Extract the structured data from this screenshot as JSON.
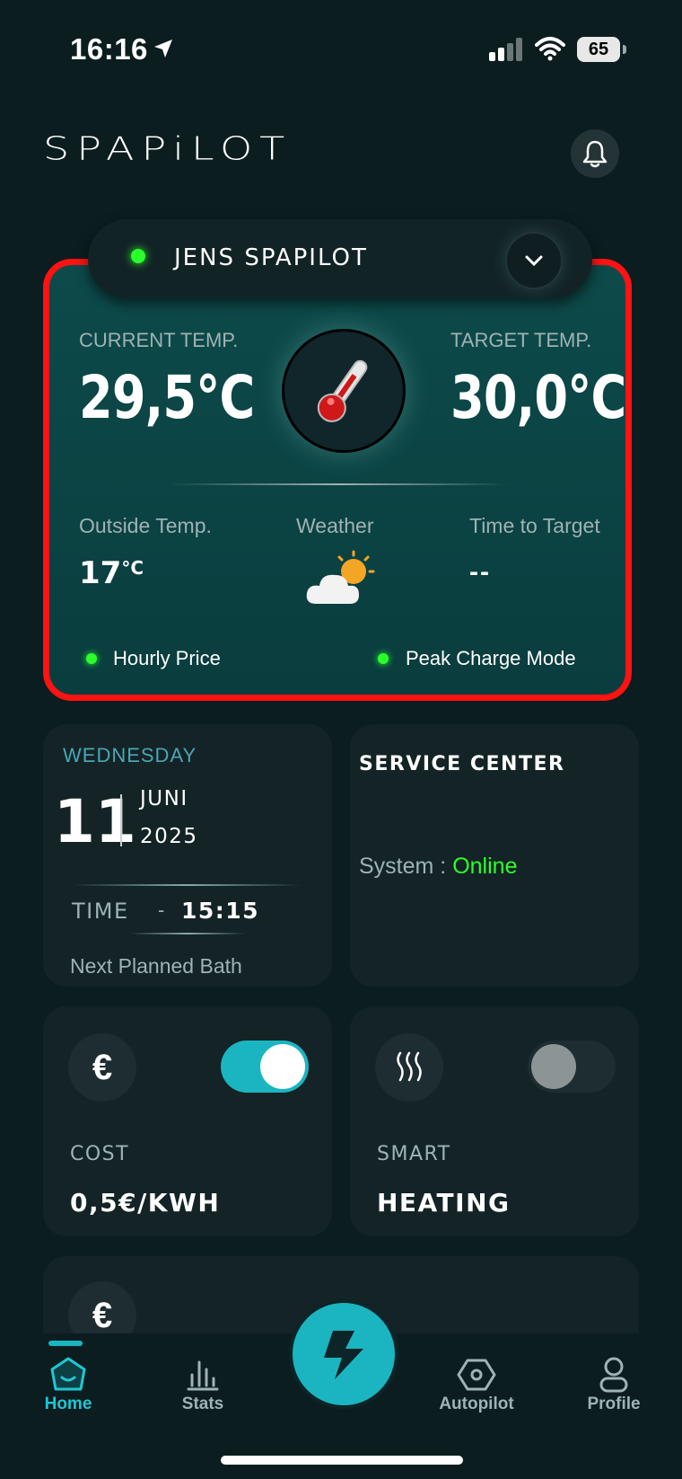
{
  "status_bar": {
    "time": "16:16",
    "battery": "65"
  },
  "header": {
    "app_title": "SPAPiLOT",
    "bell_icon": "bell-icon"
  },
  "device": {
    "name": "JENS SPAPILOT",
    "status_color": "#2bff2b"
  },
  "hero": {
    "current_label": "CURRENT TEMP.",
    "current_value": "29,5°C",
    "target_label": "TARGET TEMP.",
    "target_value": "30,0°C",
    "outside_label": "Outside Temp.",
    "outside_value": "17",
    "outside_unit": "°C",
    "weather_label": "Weather",
    "weather_icon": "partly-cloudy-icon",
    "ttt_label": "Time to Target",
    "ttt_value": "--",
    "hourly_price": "Hourly Price",
    "peak_charge": "Peak Charge Mode",
    "border_color": "#ff1212"
  },
  "date_card": {
    "weekday": "WEDNESDAY",
    "day": "11",
    "month": "JUNI",
    "year": "2025",
    "time_label": "TIME",
    "time_sep": "-",
    "time_value": "15:15",
    "next_bath": "Next Planned Bath"
  },
  "service": {
    "title": "SERVICE CENTER",
    "system_label": "System :",
    "system_status": "Online",
    "status_color": "#2bff2b"
  },
  "cost": {
    "icon": "euro-icon",
    "enabled": true,
    "label": "COST",
    "value": "0,5€/KWH"
  },
  "smart": {
    "icon": "heat-waves-icon",
    "enabled": false,
    "label": "SMART",
    "value": "HEATING"
  },
  "extra_card": {
    "icon": "euro-icon"
  },
  "tabs": [
    {
      "label": "Home",
      "active": true
    },
    {
      "label": "Stats",
      "active": false
    },
    {
      "label": "Autopilot",
      "active": false
    },
    {
      "label": "Profile",
      "active": false
    }
  ],
  "accent": "#1bb5c1"
}
